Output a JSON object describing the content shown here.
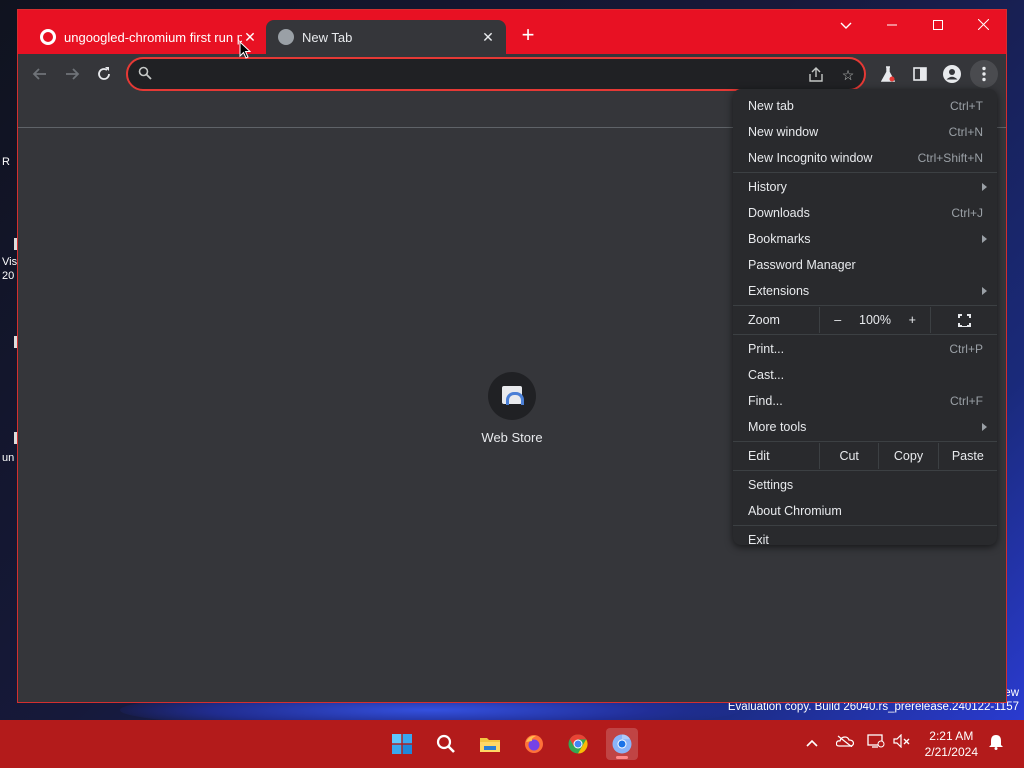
{
  "desktop": {
    "icons": [
      "R",
      "Vis",
      "20",
      "un"
    ],
    "watermark": {
      "line1": "ew",
      "line2": "Evaluation copy. Build 26040.rs_prerelease.240122-1157"
    }
  },
  "browser": {
    "tabs": [
      {
        "title": "ungoogled-chromium first run p",
        "active": false
      },
      {
        "title": "New Tab",
        "active": true
      }
    ],
    "omnibox": {
      "value": "",
      "placeholder": ""
    },
    "shortcut": {
      "label": "Web Store"
    },
    "colors": {
      "titlebar": "#e81123",
      "omnibox_border": "#e53935",
      "page_bg": "#35363a",
      "menu_bg": "#292a2d"
    }
  },
  "menu": {
    "group1": [
      {
        "label": "New tab",
        "shortcut": "Ctrl+T"
      },
      {
        "label": "New window",
        "shortcut": "Ctrl+N"
      },
      {
        "label": "New Incognito window",
        "shortcut": "Ctrl+Shift+N"
      }
    ],
    "group2": [
      {
        "label": "History",
        "shortcut": "",
        "submenu": true
      },
      {
        "label": "Downloads",
        "shortcut": "Ctrl+J"
      },
      {
        "label": "Bookmarks",
        "shortcut": "",
        "submenu": true
      },
      {
        "label": "Password Manager",
        "shortcut": ""
      },
      {
        "label": "Extensions",
        "shortcut": "",
        "submenu": true
      }
    ],
    "zoom": {
      "label": "Zoom",
      "minus": "–",
      "value": "100%",
      "plus": "+"
    },
    "group3": [
      {
        "label": "Print...",
        "shortcut": "Ctrl+P"
      },
      {
        "label": "Cast...",
        "shortcut": ""
      },
      {
        "label": "Find...",
        "shortcut": "Ctrl+F"
      },
      {
        "label": "More tools",
        "shortcut": "",
        "submenu": true
      }
    ],
    "edit": {
      "label": "Edit",
      "cut": "Cut",
      "copy": "Copy",
      "paste": "Paste"
    },
    "group4": [
      {
        "label": "Settings"
      },
      {
        "label": "About Chromium"
      }
    ],
    "exit": {
      "label": "Exit"
    }
  },
  "taskbar": {
    "apps": [
      "start-icon",
      "search-icon",
      "file-explorer-icon",
      "firefox-icon",
      "chrome-icon",
      "chromium-icon"
    ],
    "clock": {
      "time": "2:21 AM",
      "date": "2/21/2024"
    }
  }
}
